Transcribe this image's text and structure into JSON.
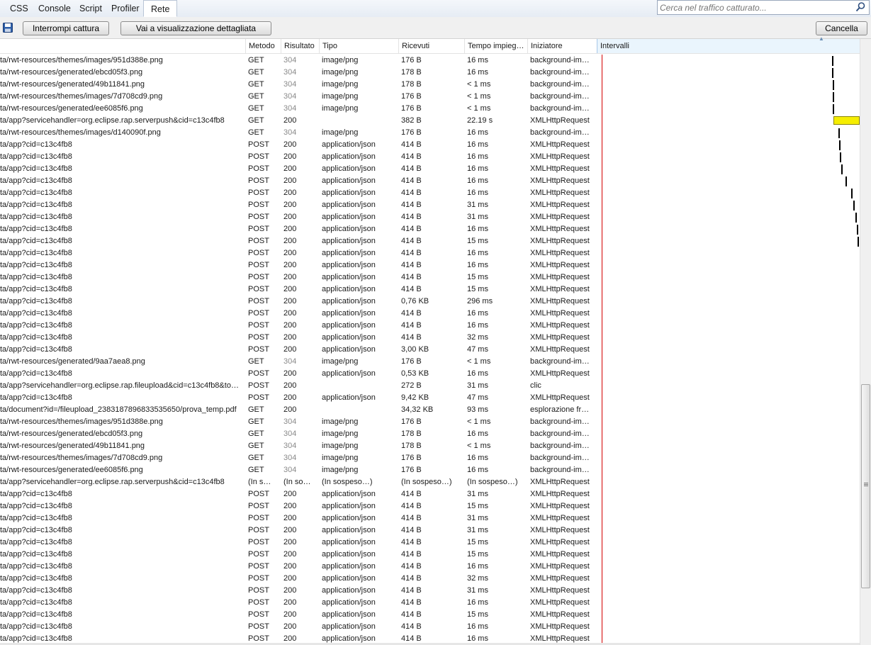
{
  "tabs": [
    {
      "label": "CSS",
      "active": false
    },
    {
      "label": "Console",
      "active": false
    },
    {
      "label": "Script",
      "active": false
    },
    {
      "label": "Profiler",
      "active": false
    },
    {
      "label": "Rete",
      "active": true
    }
  ],
  "search": {
    "placeholder": "Cerca nel traffico catturato..."
  },
  "toolbar": {
    "stop_label": "Interrompi cattura",
    "detail_label": "Vai a visualizzazione dettagliata",
    "clear_label": "Cancella"
  },
  "columns": {
    "url": "",
    "method": "Metodo",
    "result": "Risultato",
    "type": "Tipo",
    "received": "Ricevuti",
    "time": "Tempo impieg…",
    "initiator": "Iniziatore",
    "intervals": "Intervalli"
  },
  "rows": [
    {
      "url": "ta/rwt-resources/themes/images/951d388e.png",
      "method": "GET",
      "result": "304",
      "type": "image/png",
      "received": "176 B",
      "time": "16 ms",
      "initiator": "background-im…"
    },
    {
      "url": "ta/rwt-resources/generated/ebcd05f3.png",
      "method": "GET",
      "result": "304",
      "type": "image/png",
      "received": "178 B",
      "time": "16 ms",
      "initiator": "background-im…"
    },
    {
      "url": "ta/rwt-resources/generated/49b11841.png",
      "method": "GET",
      "result": "304",
      "type": "image/png",
      "received": "178 B",
      "time": "< 1 ms",
      "initiator": "background-im…"
    },
    {
      "url": "ta/rwt-resources/themes/images/7d708cd9.png",
      "method": "GET",
      "result": "304",
      "type": "image/png",
      "received": "176 B",
      "time": "< 1 ms",
      "initiator": "background-im…"
    },
    {
      "url": "ta/rwt-resources/generated/ee6085f6.png",
      "method": "GET",
      "result": "304",
      "type": "image/png",
      "received": "176 B",
      "time": "< 1 ms",
      "initiator": "background-im…"
    },
    {
      "url": "ta/app?servicehandler=org.eclipse.rap.serverpush&cid=c13c4fb8",
      "method": "GET",
      "result": "200",
      "type": "",
      "received": "382 B",
      "time": "22.19 s",
      "initiator": "XMLHttpRequest"
    },
    {
      "url": "ta/rwt-resources/themes/images/d140090f.png",
      "method": "GET",
      "result": "304",
      "type": "image/png",
      "received": "176 B",
      "time": "16 ms",
      "initiator": "background-im…"
    },
    {
      "url": "ta/app?cid=c13c4fb8",
      "method": "POST",
      "result": "200",
      "type": "application/json",
      "received": "414 B",
      "time": "16 ms",
      "initiator": "XMLHttpRequest"
    },
    {
      "url": "ta/app?cid=c13c4fb8",
      "method": "POST",
      "result": "200",
      "type": "application/json",
      "received": "414 B",
      "time": "16 ms",
      "initiator": "XMLHttpRequest"
    },
    {
      "url": "ta/app?cid=c13c4fb8",
      "method": "POST",
      "result": "200",
      "type": "application/json",
      "received": "414 B",
      "time": "16 ms",
      "initiator": "XMLHttpRequest"
    },
    {
      "url": "ta/app?cid=c13c4fb8",
      "method": "POST",
      "result": "200",
      "type": "application/json",
      "received": "414 B",
      "time": "16 ms",
      "initiator": "XMLHttpRequest"
    },
    {
      "url": "ta/app?cid=c13c4fb8",
      "method": "POST",
      "result": "200",
      "type": "application/json",
      "received": "414 B",
      "time": "16 ms",
      "initiator": "XMLHttpRequest"
    },
    {
      "url": "ta/app?cid=c13c4fb8",
      "method": "POST",
      "result": "200",
      "type": "application/json",
      "received": "414 B",
      "time": "31 ms",
      "initiator": "XMLHttpRequest"
    },
    {
      "url": "ta/app?cid=c13c4fb8",
      "method": "POST",
      "result": "200",
      "type": "application/json",
      "received": "414 B",
      "time": "31 ms",
      "initiator": "XMLHttpRequest"
    },
    {
      "url": "ta/app?cid=c13c4fb8",
      "method": "POST",
      "result": "200",
      "type": "application/json",
      "received": "414 B",
      "time": "16 ms",
      "initiator": "XMLHttpRequest"
    },
    {
      "url": "ta/app?cid=c13c4fb8",
      "method": "POST",
      "result": "200",
      "type": "application/json",
      "received": "414 B",
      "time": "15 ms",
      "initiator": "XMLHttpRequest"
    },
    {
      "url": "ta/app?cid=c13c4fb8",
      "method": "POST",
      "result": "200",
      "type": "application/json",
      "received": "414 B",
      "time": "16 ms",
      "initiator": "XMLHttpRequest"
    },
    {
      "url": "ta/app?cid=c13c4fb8",
      "method": "POST",
      "result": "200",
      "type": "application/json",
      "received": "414 B",
      "time": "16 ms",
      "initiator": "XMLHttpRequest"
    },
    {
      "url": "ta/app?cid=c13c4fb8",
      "method": "POST",
      "result": "200",
      "type": "application/json",
      "received": "414 B",
      "time": "15 ms",
      "initiator": "XMLHttpRequest"
    },
    {
      "url": "ta/app?cid=c13c4fb8",
      "method": "POST",
      "result": "200",
      "type": "application/json",
      "received": "414 B",
      "time": "15 ms",
      "initiator": "XMLHttpRequest"
    },
    {
      "url": "ta/app?cid=c13c4fb8",
      "method": "POST",
      "result": "200",
      "type": "application/json",
      "received": "0,76 KB",
      "time": "296 ms",
      "initiator": "XMLHttpRequest"
    },
    {
      "url": "ta/app?cid=c13c4fb8",
      "method": "POST",
      "result": "200",
      "type": "application/json",
      "received": "414 B",
      "time": "16 ms",
      "initiator": "XMLHttpRequest"
    },
    {
      "url": "ta/app?cid=c13c4fb8",
      "method": "POST",
      "result": "200",
      "type": "application/json",
      "received": "414 B",
      "time": "16 ms",
      "initiator": "XMLHttpRequest"
    },
    {
      "url": "ta/app?cid=c13c4fb8",
      "method": "POST",
      "result": "200",
      "type": "application/json",
      "received": "414 B",
      "time": "32 ms",
      "initiator": "XMLHttpRequest"
    },
    {
      "url": "ta/app?cid=c13c4fb8",
      "method": "POST",
      "result": "200",
      "type": "application/json",
      "received": "3,00 KB",
      "time": "47 ms",
      "initiator": "XMLHttpRequest"
    },
    {
      "url": "ta/rwt-resources/generated/9aa7aea8.png",
      "method": "GET",
      "result": "304",
      "type": "image/png",
      "received": "176 B",
      "time": "< 1 ms",
      "initiator": "background-im…"
    },
    {
      "url": "ta/app?cid=c13c4fb8",
      "method": "POST",
      "result": "200",
      "type": "application/json",
      "received": "0,53 KB",
      "time": "16 ms",
      "initiator": "XMLHttpRequest"
    },
    {
      "url": "ta/app?servicehandler=org.eclipse.rap.fileupload&cid=c13c4fb8&to…",
      "method": "POST",
      "result": "200",
      "type": "",
      "received": "272 B",
      "time": "31 ms",
      "initiator": "clic"
    },
    {
      "url": "ta/app?cid=c13c4fb8",
      "method": "POST",
      "result": "200",
      "type": "application/json",
      "received": "9,42 KB",
      "time": "47 ms",
      "initiator": "XMLHttpRequest"
    },
    {
      "url": "ta/document?id=/fileupload_2383187896833535650/prova_temp.pdf",
      "method": "GET",
      "result": "200",
      "type": "",
      "received": "34,32 KB",
      "time": "93 ms",
      "initiator": "esplorazione fr…"
    },
    {
      "url": "ta/rwt-resources/themes/images/951d388e.png",
      "method": "GET",
      "result": "304",
      "type": "image/png",
      "received": "176 B",
      "time": "< 1 ms",
      "initiator": "background-im…"
    },
    {
      "url": "ta/rwt-resources/generated/ebcd05f3.png",
      "method": "GET",
      "result": "304",
      "type": "image/png",
      "received": "178 B",
      "time": "16 ms",
      "initiator": "background-im…"
    },
    {
      "url": "ta/rwt-resources/generated/49b11841.png",
      "method": "GET",
      "result": "304",
      "type": "image/png",
      "received": "178 B",
      "time": "< 1 ms",
      "initiator": "background-im…"
    },
    {
      "url": "ta/rwt-resources/themes/images/7d708cd9.png",
      "method": "GET",
      "result": "304",
      "type": "image/png",
      "received": "176 B",
      "time": "16 ms",
      "initiator": "background-im…"
    },
    {
      "url": "ta/rwt-resources/generated/ee6085f6.png",
      "method": "GET",
      "result": "304",
      "type": "image/png",
      "received": "176 B",
      "time": "16 ms",
      "initiator": "background-im…"
    },
    {
      "url": "ta/app?servicehandler=org.eclipse.rap.serverpush&cid=c13c4fb8",
      "method": "(In s…",
      "result": "(In so…",
      "type": "(In sospeso…)",
      "received": "(In sospeso…)",
      "time": "(In sospeso…)",
      "initiator": "XMLHttpRequest"
    },
    {
      "url": "ta/app?cid=c13c4fb8",
      "method": "POST",
      "result": "200",
      "type": "application/json",
      "received": "414 B",
      "time": "31 ms",
      "initiator": "XMLHttpRequest"
    },
    {
      "url": "ta/app?cid=c13c4fb8",
      "method": "POST",
      "result": "200",
      "type": "application/json",
      "received": "414 B",
      "time": "15 ms",
      "initiator": "XMLHttpRequest"
    },
    {
      "url": "ta/app?cid=c13c4fb8",
      "method": "POST",
      "result": "200",
      "type": "application/json",
      "received": "414 B",
      "time": "31 ms",
      "initiator": "XMLHttpRequest"
    },
    {
      "url": "ta/app?cid=c13c4fb8",
      "method": "POST",
      "result": "200",
      "type": "application/json",
      "received": "414 B",
      "time": "31 ms",
      "initiator": "XMLHttpRequest"
    },
    {
      "url": "ta/app?cid=c13c4fb8",
      "method": "POST",
      "result": "200",
      "type": "application/json",
      "received": "414 B",
      "time": "15 ms",
      "initiator": "XMLHttpRequest"
    },
    {
      "url": "ta/app?cid=c13c4fb8",
      "method": "POST",
      "result": "200",
      "type": "application/json",
      "received": "414 B",
      "time": "15 ms",
      "initiator": "XMLHttpRequest"
    },
    {
      "url": "ta/app?cid=c13c4fb8",
      "method": "POST",
      "result": "200",
      "type": "application/json",
      "received": "414 B",
      "time": "16 ms",
      "initiator": "XMLHttpRequest"
    },
    {
      "url": "ta/app?cid=c13c4fb8",
      "method": "POST",
      "result": "200",
      "type": "application/json",
      "received": "414 B",
      "time": "32 ms",
      "initiator": "XMLHttpRequest"
    },
    {
      "url": "ta/app?cid=c13c4fb8",
      "method": "POST",
      "result": "200",
      "type": "application/json",
      "received": "414 B",
      "time": "31 ms",
      "initiator": "XMLHttpRequest"
    },
    {
      "url": "ta/app?cid=c13c4fb8",
      "method": "POST",
      "result": "200",
      "type": "application/json",
      "received": "414 B",
      "time": "16 ms",
      "initiator": "XMLHttpRequest"
    },
    {
      "url": "ta/app?cid=c13c4fb8",
      "method": "POST",
      "result": "200",
      "type": "application/json",
      "received": "414 B",
      "time": "15 ms",
      "initiator": "XMLHttpRequest"
    },
    {
      "url": "ta/app?cid=c13c4fb8",
      "method": "POST",
      "result": "200",
      "type": "application/json",
      "received": "414 B",
      "time": "16 ms",
      "initiator": "XMLHttpRequest"
    },
    {
      "url": "ta/app?cid=c13c4fb8",
      "method": "POST",
      "result": "200",
      "type": "application/json",
      "received": "414 B",
      "time": "16 ms",
      "initiator": "XMLHttpRequest"
    }
  ],
  "colors": {
    "marker_line": "#d40000",
    "interval_bar": "#f6ee00",
    "interval_tick": "#000000"
  },
  "icons": {
    "save": "save-icon",
    "search": "magnifier-icon"
  }
}
